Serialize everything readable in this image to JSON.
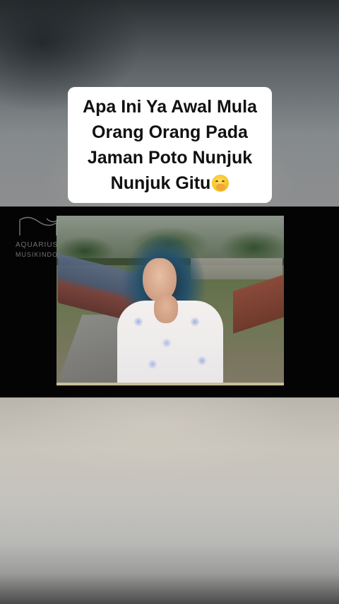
{
  "caption": {
    "lines": [
      "Apa Ini Ya Awal Mula",
      "Orang Orang Pada",
      "Jaman Poto Nunjuk",
      "Nunjuk Gitu"
    ],
    "emoji_icon": "face-with-hand-over-mouth-icon"
  },
  "watermark": {
    "line1": "AQUARIUS",
    "line2": "MUSIKINDO",
    "logo_icon": "aquarius-wave-logo"
  },
  "colors": {
    "caption_bg": "#ffffff",
    "caption_text": "#111111",
    "video_band": "#040404"
  }
}
